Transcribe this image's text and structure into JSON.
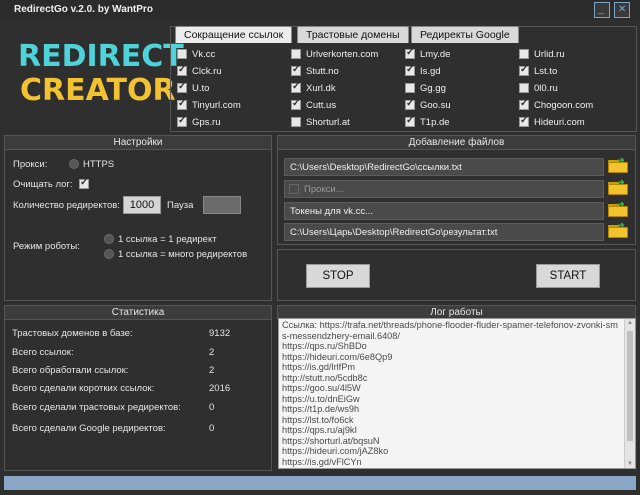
{
  "window": {
    "title": "RedirectGo v.2.0. by WantPro",
    "minimize_icon": "minimize-icon",
    "close_icon": "close-icon"
  },
  "logo": {
    "line1": "REDIRECT",
    "line2": "CREATOR"
  },
  "tabs": [
    {
      "label": "Сокращение ссылок",
      "active": true
    },
    {
      "label": "Трастовые домены",
      "active": false
    },
    {
      "label": "Редиректы Google",
      "active": false
    }
  ],
  "domains": {
    "col1": [
      {
        "name": "Vk.cc",
        "checked": false
      },
      {
        "name": "Clck.ru",
        "checked": true
      },
      {
        "name": "U.to",
        "checked": true
      },
      {
        "name": "Tinyurl.com",
        "checked": true
      },
      {
        "name": "Gps.ru",
        "checked": true
      }
    ],
    "col2": [
      {
        "name": "Urlverkorten.com",
        "checked": false
      },
      {
        "name": "Stutt.no",
        "checked": true
      },
      {
        "name": "Xurl.dk",
        "checked": true
      },
      {
        "name": "Cutt.us",
        "checked": true
      },
      {
        "name": "Shorturl.at",
        "checked": false
      }
    ],
    "col3": [
      {
        "name": "Lmy.de",
        "checked": true
      },
      {
        "name": "Is.gd",
        "checked": true
      },
      {
        "name": "Gg.gg",
        "checked": false
      },
      {
        "name": "Goo.su",
        "checked": true
      },
      {
        "name": "T1p.de",
        "checked": true
      }
    ],
    "col4": [
      {
        "name": "Urlid.ru",
        "checked": false
      },
      {
        "name": "Lst.to",
        "checked": true
      },
      {
        "name": "0l0.ru",
        "checked": false
      },
      {
        "name": "Chogoon.com",
        "checked": true
      },
      {
        "name": "Hideuri.com",
        "checked": true
      }
    ]
  },
  "settings": {
    "header": "Настройки",
    "proxy_label": "Прокси:",
    "proxy_option": "HTTPS",
    "clear_log_label": "Очищать лог:",
    "redirect_count_label": "Количество редиректов:",
    "redirect_count_value": "1000",
    "pause_label": "Пауза",
    "pause_value": "",
    "mode_label": "Режим роботы:",
    "mode_option1": "1 ссылка = 1 редирект",
    "mode_option2": "1 ссылка = много редиректов"
  },
  "files": {
    "header": "Добавление файлов",
    "links_path": "C:\\Users\\Desktop\\RedirectGo\\ссылки.txt",
    "proxy_placeholder": "Прокси...",
    "tokens_placeholder": "Токены для vk.cc...",
    "result_path": "C:\\Users\\Царь\\Desktop\\RedirectGo\\результат.txt"
  },
  "actions": {
    "stop_label": "STOP",
    "start_label": "START"
  },
  "stats": {
    "header": "Статистика",
    "rows": [
      {
        "label": "Трастовых доменов в базе:",
        "value": "9132"
      },
      {
        "label": "Всего ссылок:",
        "value": "2"
      },
      {
        "label": "Всего обработали ссылок:",
        "value": "2"
      },
      {
        "label": "Всего сделали коротких ссылок:",
        "value": "2016"
      },
      {
        "label": "Всего сделали трастовых редиректов:",
        "value": "0"
      },
      {
        "label": "Всего сделали Google редиректов:",
        "value": "0"
      }
    ]
  },
  "log": {
    "header": "Лог работы",
    "lines": [
      "Ссылка: https://trafa.net/threads/phone-flooder-fluder-spamer-telefonov-zvonki-sms-messendzhery-email.6408/",
      "https://qps.ru/ShBDo",
      "https://hideuri.com/6e8Qp9",
      "https://is.gd/lrlfPm",
      "http://stutt.no/5cdb8c",
      "https://goo.su/4l5W",
      "https://u.to/dnEiGw",
      "https://t1p.de/ws9h",
      "https://lst.to/fo6ck",
      "https://qps.ru/aj9kI",
      "https://shorturl.at/bqsuN",
      "https://hideuri.com/jAZ8ko",
      "https://is.gd/vFlCYn"
    ]
  },
  "colors": {
    "logo_top": "#4ed4d8",
    "logo_bottom": "#f2c230",
    "background": "#2f2f2f",
    "statusbar": "#8aa6c6"
  }
}
